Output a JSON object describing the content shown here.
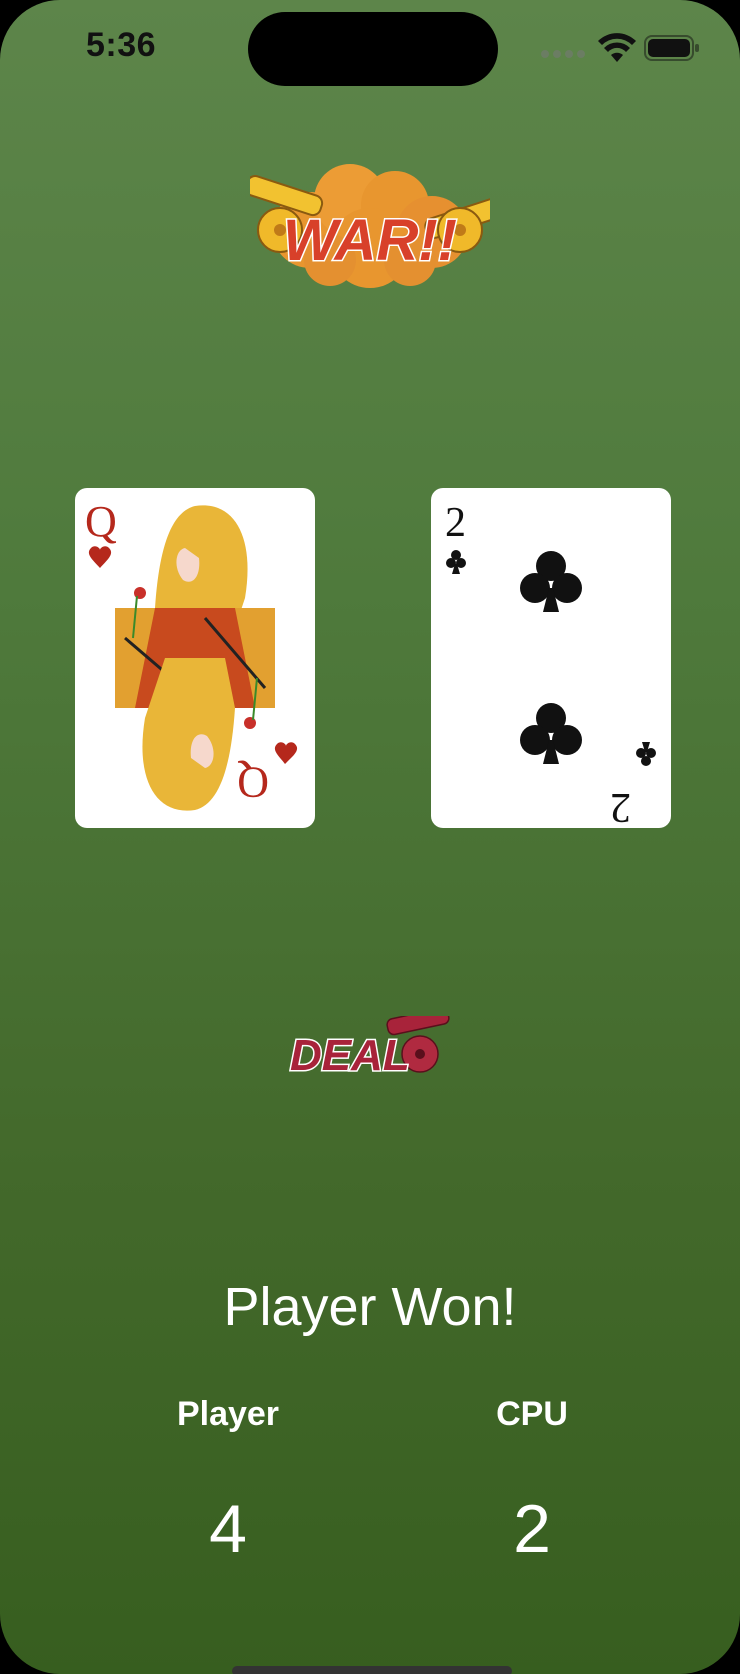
{
  "status_bar": {
    "time": "5:36",
    "icons": [
      "cellular-icon",
      "wifi-icon",
      "battery-icon"
    ]
  },
  "logo": {
    "text": "WAR!!",
    "icon": "cannon-icon"
  },
  "cards": {
    "player": {
      "rank": "Q",
      "suit": "hearts"
    },
    "cpu": {
      "rank": "2",
      "suit": "clubs"
    }
  },
  "deal_button": {
    "label": "DEAL",
    "icon": "cannon-icon"
  },
  "result_text": "Player Won!",
  "scores": {
    "player_label": "Player",
    "cpu_label": "CPU",
    "player": "4",
    "cpu": "2"
  },
  "colors": {
    "background_top": "#5d854a",
    "background_bottom": "#375e1f",
    "logo_orange": "#e8962f",
    "deal_red": "#a8233a",
    "heart_red": "#b5281c"
  }
}
